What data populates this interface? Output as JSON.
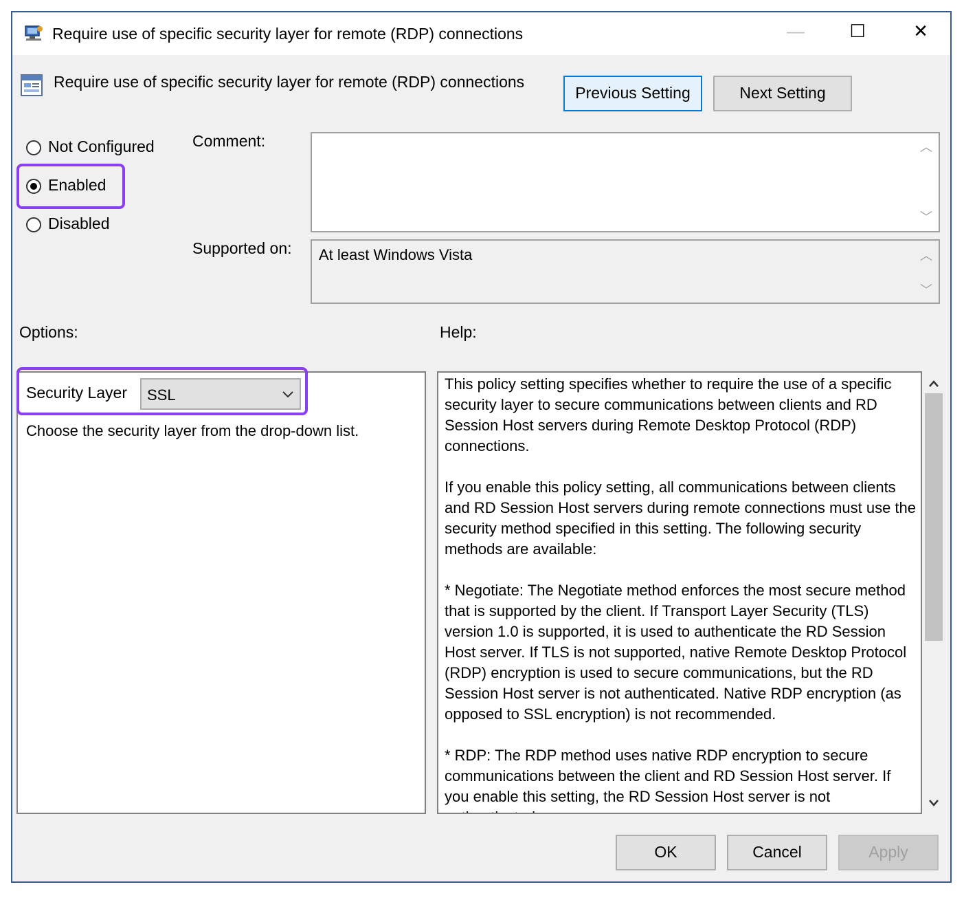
{
  "window": {
    "title": "Require use of specific security layer for remote (RDP) connections",
    "controls": {
      "minimize": "—",
      "maximize": "☐",
      "close": "✕"
    }
  },
  "header": {
    "setting_name": "Require use of specific security layer for remote (RDP) connections",
    "previous_label": "Previous Setting",
    "next_label": "Next Setting"
  },
  "state": {
    "options": [
      {
        "label": "Not Configured",
        "selected": false
      },
      {
        "label": "Enabled",
        "selected": true
      },
      {
        "label": "Disabled",
        "selected": false
      }
    ]
  },
  "comment": {
    "label": "Comment:",
    "value": ""
  },
  "supported": {
    "label": "Supported on:",
    "value": "At least Windows Vista"
  },
  "options_panel": {
    "label": "Options:",
    "security_layer_label": "Security Layer",
    "security_layer_value": "SSL",
    "instruction": "Choose the security layer from the drop-down list."
  },
  "help": {
    "label": "Help:",
    "paragraphs": [
      "This policy setting specifies whether to require the use of a specific security layer to secure communications between clients and RD Session Host servers during Remote Desktop Protocol (RDP) connections.",
      "If you enable this policy setting, all communications between clients and RD Session Host servers during remote connections must use the security method specified in this setting. The following security methods are available:",
      "* Negotiate: The Negotiate method enforces the most secure method that is supported by the client. If Transport Layer Security (TLS) version 1.0 is supported, it is used to authenticate the RD Session Host server. If TLS is not supported, native Remote Desktop Protocol (RDP) encryption is used to secure communications, but the RD Session Host server is not authenticated. Native RDP encryption (as opposed to SSL encryption) is not recommended.",
      "* RDP: The RDP method uses native RDP encryption to secure communications between the client and RD Session Host server. If you enable this setting, the RD Session Host server is not authenticated."
    ]
  },
  "footer": {
    "ok_label": "OK",
    "cancel_label": "Cancel",
    "apply_label": "Apply"
  },
  "colors": {
    "highlight": "#8a3ff0",
    "focus": "#0078d7"
  }
}
